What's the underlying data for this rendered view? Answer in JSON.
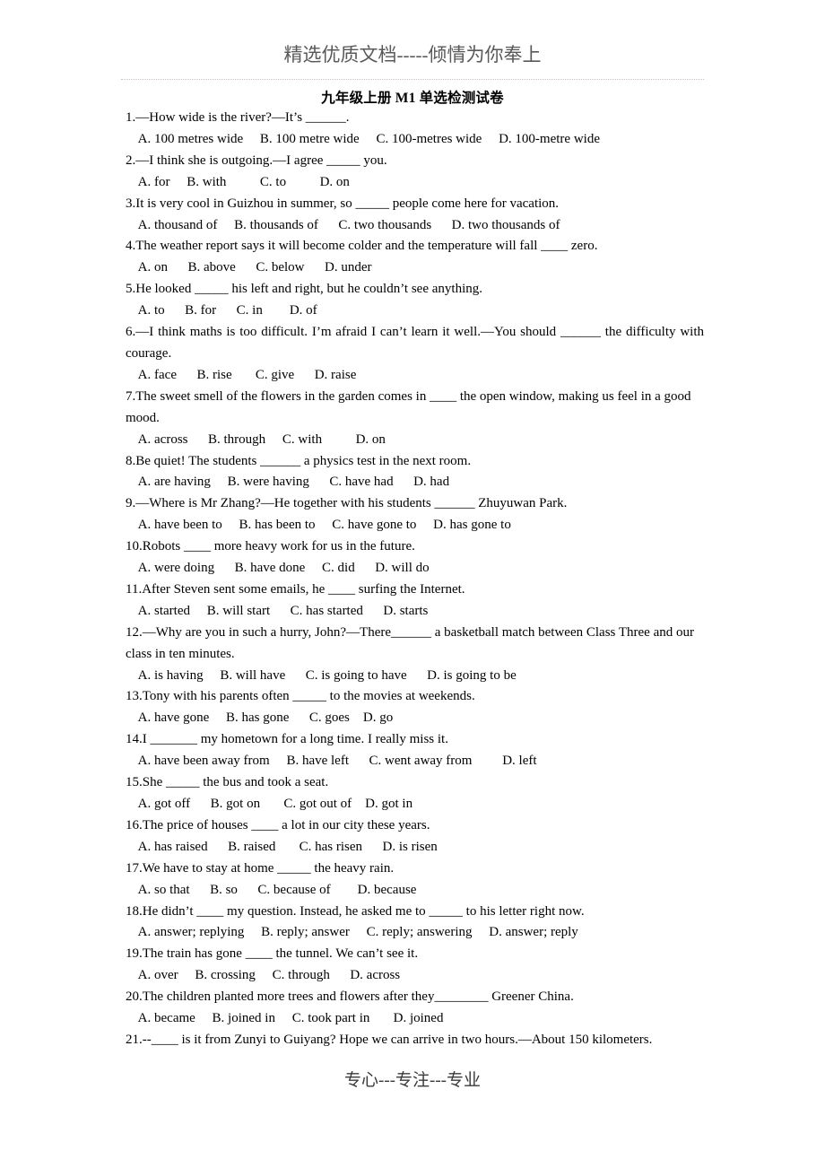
{
  "page": {
    "header_watermark": "精选优质文档-----倾情为你奉上",
    "footer_watermark": "专心---专注---专业",
    "title": "九年级上册 M1 单选检测试卷",
    "rule_color": "#c8c2c6"
  },
  "questions": [
    {
      "number": "1",
      "stem": "1.—How wide is the river?—It’s ______.",
      "justify": false,
      "options": "  A. 100 metres wide     B. 100 metre wide     C. 100-metres wide     D. 100-metre wide"
    },
    {
      "number": "2",
      "stem": "2.—I think she is outgoing.—I agree _____ you.",
      "justify": false,
      "options": "  A. for     B. with          C. to          D. on"
    },
    {
      "number": "3",
      "stem": "3.It is very cool in Guizhou in summer, so _____ people come here for vacation.",
      "justify": false,
      "options": "  A. thousand of     B. thousands of      C. two thousands      D. two thousands of"
    },
    {
      "number": "4",
      "stem": "4.The weather report says it will become colder and the temperature will fall ____ zero.",
      "justify": false,
      "options": "  A. on      B. above      C. below      D. under"
    },
    {
      "number": "5",
      "stem": "5.He looked _____ his left and right, but he couldn’t see anything.",
      "justify": false,
      "options": "  A. to      B. for      C. in        D. of"
    },
    {
      "number": "6",
      "stem": "6.—I think maths is too difficult. I’m afraid I can’t learn it well.—You should ______ the difficulty with courage.",
      "justify": true,
      "options": "  A. face      B. rise       C. give      D. raise"
    },
    {
      "number": "7",
      "stem": "7.The sweet smell of the flowers in the garden comes in ____ the open window, making us feel in a good mood.",
      "justify": false,
      "options": "  A. across      B. through     C. with          D. on"
    },
    {
      "number": "8",
      "stem": "8.Be quiet! The students ______ a physics test in the next room.",
      "justify": false,
      "options": "  A. are having     B. were having      C. have had      D. had"
    },
    {
      "number": "9",
      "stem": "9.—Where is Mr Zhang?—He together with his students ______ Zhuyuwan Park.",
      "justify": false,
      "options": "  A. have been to     B. has been to     C. have gone to     D. has gone to"
    },
    {
      "number": "10",
      "stem": "10.Robots ____ more heavy work for us in the future.",
      "justify": false,
      "options": "  A. were doing      B. have done     C. did      D. will do"
    },
    {
      "number": "11",
      "stem": "11.After Steven sent some emails, he ____ surfing the Internet.",
      "justify": false,
      "options": "  A. started     B. will start      C. has started      D. starts"
    },
    {
      "number": "12",
      "stem": "12.—Why are you in such a hurry, John?—There______ a basketball match between Class Three and our class in ten minutes.",
      "justify": false,
      "options": "  A. is having     B. will have      C. is going to have      D. is going to be"
    },
    {
      "number": "13",
      "stem": "13.Tony with his parents often _____ to the movies at weekends.",
      "justify": false,
      "options": "  A. have gone     B. has gone      C. goes    D. go"
    },
    {
      "number": "14",
      "stem": "14.I _______ my hometown for a long time. I really miss it.",
      "justify": false,
      "options": "  A. have been away from     B. have left      C. went away from         D. left"
    },
    {
      "number": "15",
      "stem": "15.She _____ the bus and took a seat.",
      "justify": false,
      "options": "  A. got off      B. got on       C. got out of    D. got in"
    },
    {
      "number": "16",
      "stem": "16.The price of houses ____ a lot in our city these years.",
      "justify": false,
      "options": "  A. has raised      B. raised       C. has risen      D. is risen"
    },
    {
      "number": "17",
      "stem": "17.We have to stay at home _____ the heavy rain.",
      "justify": false,
      "options": "  A. so that      B. so      C. because of        D. because"
    },
    {
      "number": "18",
      "stem": "18.He didn’t ____ my question. Instead, he asked me to _____ to his letter right now.",
      "justify": false,
      "options": "  A. answer; replying     B. reply; answer     C. reply; answering     D. answer; reply"
    },
    {
      "number": "19",
      "stem": "19.The train has gone ____ the tunnel. We can’t see it.",
      "justify": false,
      "options": "  A. over     B. crossing     C. through      D. across"
    },
    {
      "number": "20",
      "stem": "20.The children planted more trees and flowers after they________ Greener China.",
      "justify": false,
      "options": "  A. became     B. joined in     C. took part in       D. joined"
    },
    {
      "number": "21",
      "stem": "21.--____ is it from Zunyi to Guiyang? Hope we can arrive in two hours.—About 150 kilometers.",
      "justify": false,
      "options": null
    }
  ]
}
